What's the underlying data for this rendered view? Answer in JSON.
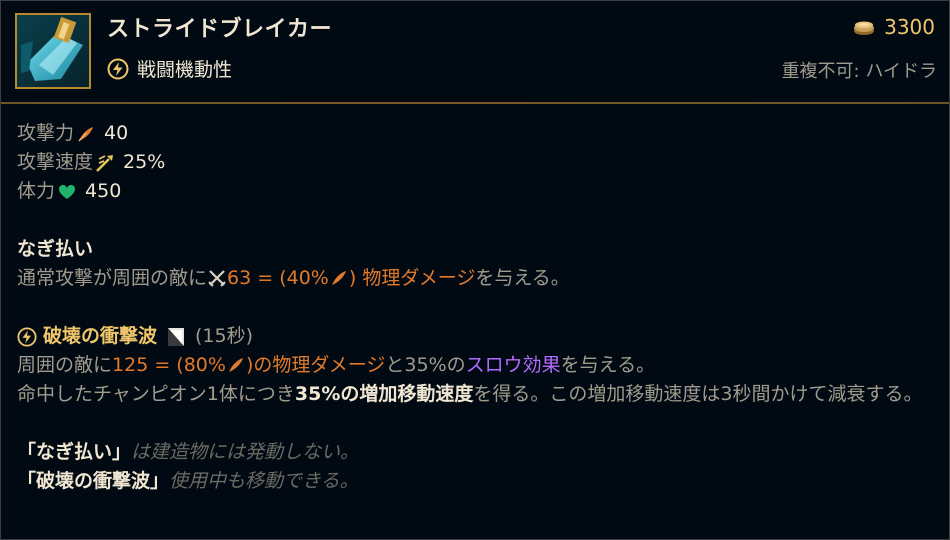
{
  "item": {
    "name": "ストライドブレイカー",
    "icon": "stridebreaker-icon",
    "tag_icon": "lightning-icon",
    "tag_label": "戦闘機動性",
    "gold_icon": "gold-coins-icon",
    "cost": "3300",
    "unique": "重複不可: ハイドラ"
  },
  "stats": [
    {
      "label": "攻撃力",
      "icon": "attack-damage-icon",
      "value": "40"
    },
    {
      "label": "攻撃速度",
      "icon": "attack-speed-icon",
      "value": "25%"
    },
    {
      "label": "体力",
      "icon": "health-icon",
      "value": "450"
    }
  ],
  "passive": {
    "name": "なぎ払い",
    "text_pre": "通常攻撃が周囲の敵に",
    "icon": "crossed-swords-icon",
    "damage_a": "63 = (40%",
    "ad_icon": "attack-damage-icon",
    "damage_b": ")",
    "damage_type": "物理ダメージ",
    "text_post": "を与える。"
  },
  "active": {
    "icon": "lightning-icon",
    "name": "破壊の衝撃波",
    "cd_icon": "cooldown-icon",
    "cooldown": "(15秒)",
    "line1_pre": "周囲の敵に",
    "line1_dmg_a": "125 = (80%",
    "line1_dmg_b": ")",
    "line1_dmg_type": "の物理ダメージ",
    "line1_mid": "と35%の",
    "line1_slow": "スロウ効果",
    "line1_post": "を与える。",
    "line2_pre": "命中したチャンピオン1体につき",
    "line2_bold": "35%の増加移動速度",
    "line2_post": "を得る。この増加移動速度は3秒間かけて減衰する。"
  },
  "notes": [
    {
      "bold": "「なぎ払い」",
      "italic": "は建造物には発動しない。"
    },
    {
      "bold": "「破壊の衝撃波」",
      "italic": "使用中も移動できる。"
    }
  ],
  "colors": {
    "background": "#010a13",
    "gold_border": "#785a28",
    "orange": "#e37a2a",
    "purple": "#b46bff",
    "heading": "#f0e6d2"
  }
}
